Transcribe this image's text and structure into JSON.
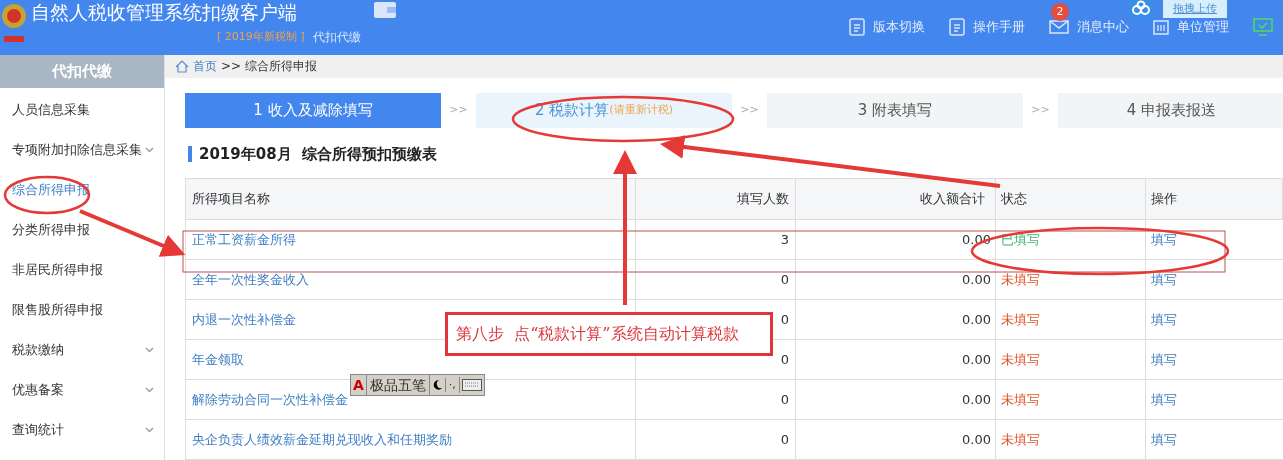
{
  "header": {
    "title": "自然人税收管理系统扣缴客户端",
    "edition": "[ 2019年新税制 ]",
    "module": "代扣代缴",
    "nav": [
      {
        "kind": "doc",
        "label": "版本切换"
      },
      {
        "kind": "doc",
        "label": "操作手册"
      },
      {
        "kind": "mail",
        "label": "消息中心",
        "badge": "2"
      },
      {
        "kind": "unit",
        "label": "单位管理"
      },
      {
        "kind": "screen"
      }
    ],
    "upload_widget": {
      "label": "拖拽上传"
    }
  },
  "sidebar": {
    "title": "代扣代缴",
    "items": [
      {
        "label": "人员信息采集",
        "selected": false,
        "expandable": false
      },
      {
        "label": "专项附加扣除信息采集",
        "selected": false,
        "expandable": true
      },
      {
        "label": "综合所得申报",
        "selected": true,
        "expandable": false
      },
      {
        "label": "分类所得申报",
        "selected": false,
        "expandable": false
      },
      {
        "label": "非居民所得申报",
        "selected": false,
        "expandable": false
      },
      {
        "label": "限售股所得申报",
        "selected": false,
        "expandable": false
      },
      {
        "label": "税款缴纳",
        "selected": false,
        "expandable": true
      },
      {
        "label": "优惠备案",
        "selected": false,
        "expandable": true
      },
      {
        "label": "查询统计",
        "selected": false,
        "expandable": true
      }
    ]
  },
  "breadcrumb": {
    "home": "首页",
    "separator": ">>",
    "current": "综合所得申报"
  },
  "steps": [
    {
      "label": "1 收入及减除填写",
      "selected": true
    },
    {
      "label": "2 税款计算",
      "note": "(请重新计税)",
      "selected": false
    },
    {
      "label": "3 附表填写",
      "selected": false
    },
    {
      "label": "4 申报表报送",
      "selected": false
    }
  ],
  "step_separator": ">>",
  "table_title": "2019年08月  综合所得预扣预缴表",
  "table": {
    "columns": [
      "所得项目名称",
      "填写人数",
      "收入额合计",
      "状态",
      "操作"
    ],
    "rows": [
      {
        "name": "正常工资薪金所得",
        "count": "3",
        "total": "0.00",
        "status": "已填写",
        "filled": true,
        "action": "填写"
      },
      {
        "name": "全年一次性奖金收入",
        "count": "0",
        "total": "0.00",
        "status": "未填写",
        "filled": false,
        "action": "填写"
      },
      {
        "name": "内退一次性补偿金",
        "count": "0",
        "total": "0.00",
        "status": "未填写",
        "filled": false,
        "action": "填写"
      },
      {
        "name": "年金领取",
        "count": "0",
        "total": "0.00",
        "status": "未填写",
        "filled": false,
        "action": "填写"
      },
      {
        "name": "解除劳动合同一次性补偿金",
        "count": "0",
        "total": "0.00",
        "status": "未填写",
        "filled": false,
        "action": "填写"
      },
      {
        "name": "央企负责人绩效薪金延期兑现收入和任期奖励",
        "count": "0",
        "total": "0.00",
        "status": "未填写",
        "filled": false,
        "action": "填写"
      }
    ]
  },
  "annotation": {
    "text": "第八步  点“税款计算”系统自动计算税款"
  },
  "ime_toolbar": {
    "mode": "A",
    "name": "极品五笔",
    "punct": "·,"
  }
}
